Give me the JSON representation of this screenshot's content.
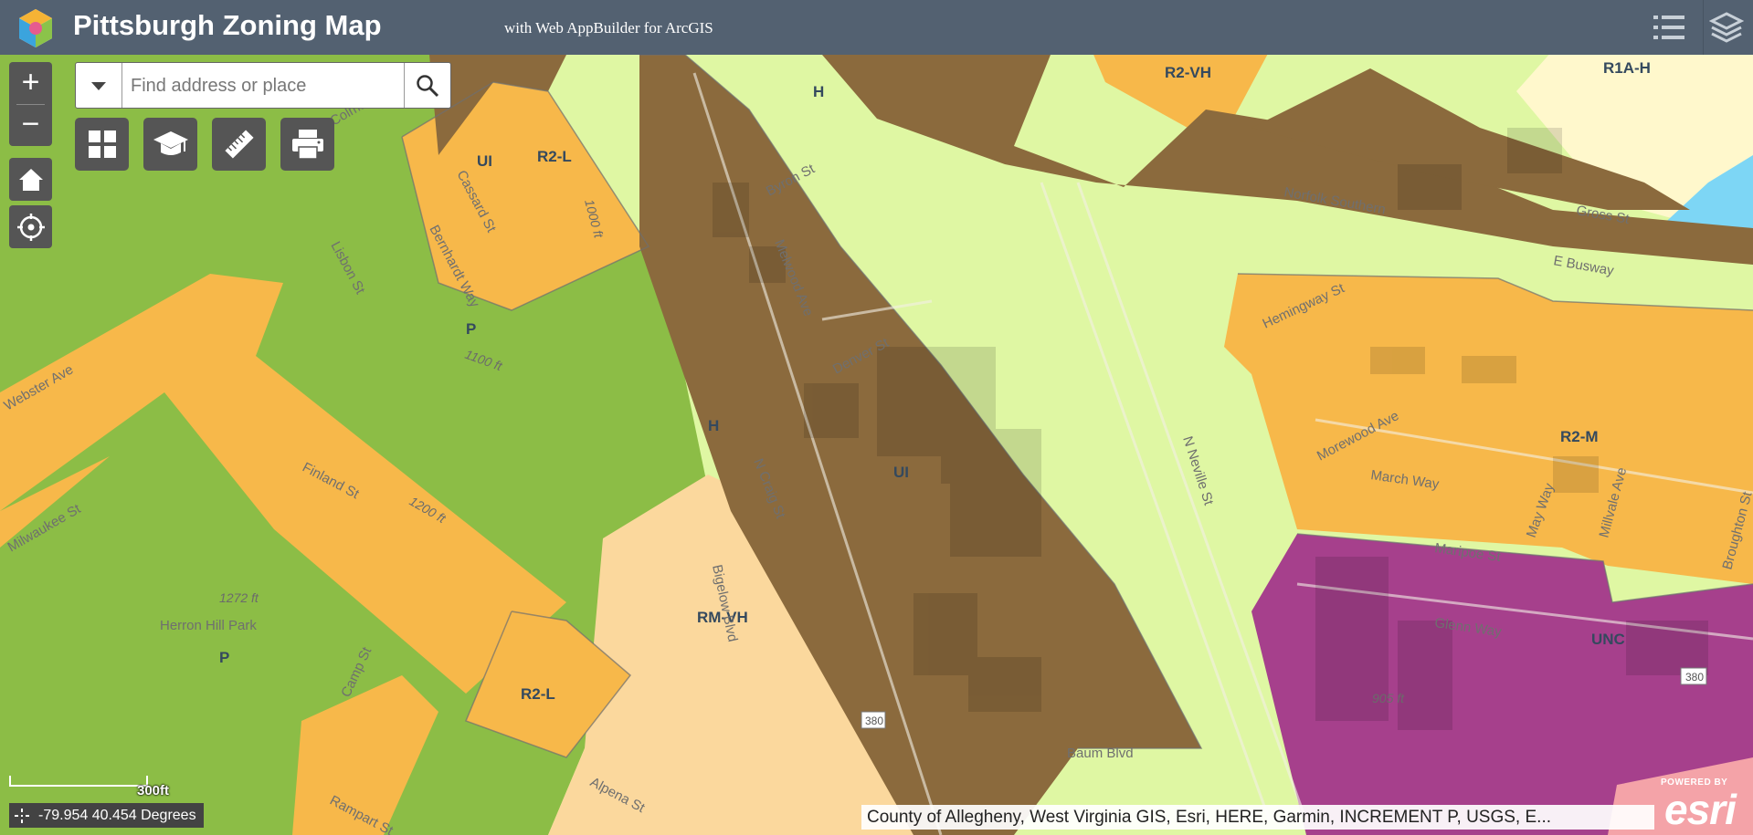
{
  "header": {
    "title": "Pittsburgh Zoning Map",
    "subtitle": "with Web AppBuilder for ArcGIS",
    "buttons": [
      {
        "icon": "legend-list-icon"
      },
      {
        "icon": "layers-icon"
      }
    ]
  },
  "search": {
    "placeholder": "Find address or place",
    "value": ""
  },
  "map_controls": {
    "zoom_in": "+",
    "zoom_out": "−",
    "home_icon": "home-icon",
    "locate_icon": "locate-icon"
  },
  "toolbar": [
    {
      "icon": "basemap-gallery-icon"
    },
    {
      "icon": "graduation-cap-icon"
    },
    {
      "icon": "measure-ruler-icon"
    },
    {
      "icon": "print-icon"
    }
  ],
  "scale": {
    "label": "300ft"
  },
  "coordinates": {
    "text": "-79.954 40.454 Degrees"
  },
  "attribution": "County of Allegheny, West Virginia GIS, Esri, HERE, Garmin, INCREMENT P, USGS, E...",
  "esri_logo": {
    "powered_by": "POWERED BY",
    "brand": "esri"
  },
  "zoning_labels": [
    {
      "text": "H"
    },
    {
      "text": "R2-VH"
    },
    {
      "text": "R1A-H"
    },
    {
      "text": "UI"
    },
    {
      "text": "R2-L"
    },
    {
      "text": "P"
    },
    {
      "text": "H"
    },
    {
      "text": "UI"
    },
    {
      "text": "R2-M"
    },
    {
      "text": "RM-VH"
    },
    {
      "text": "P"
    },
    {
      "text": "R2-L"
    },
    {
      "text": "UNC"
    }
  ],
  "street_labels": [
    "Byron St",
    "Melwood Ave",
    "Denver St",
    "N Craig St",
    "Bigelow Blvd",
    "Norfolk Southern",
    "Gross St",
    "E Busway",
    "Hemingway St",
    "Morewood Ave",
    "March Way",
    "May Way",
    "Maripoe St",
    "Glenn Way",
    "Millvale Ave",
    "Broughton St",
    "N Neville St",
    "Lisbon St",
    "Bernhardt Way",
    "Finland St",
    "Milwaukee St",
    "Webster Ave",
    "Camp St",
    "Rampart St",
    "Alpena St",
    "Baum Blvd",
    "Herron Hill Park",
    "Colma",
    "Cassard St"
  ],
  "elevation_labels": [
    "1000 ft",
    "1100 ft",
    "1200 ft",
    "1272 ft",
    "905 ft"
  ],
  "route_shields": [
    "380",
    "380"
  ],
  "zone_colors": {
    "industrial": "#8b6a3d",
    "residential": "#f7b84a",
    "residential_light": "#f9d79a",
    "park": "#8cbd46",
    "highway": "#dff7a3",
    "commercial": "#a6408c",
    "pink": "#f4a3a8",
    "cream": "#fff7c8",
    "blue": "#7dd6f5",
    "header": "#536171"
  }
}
